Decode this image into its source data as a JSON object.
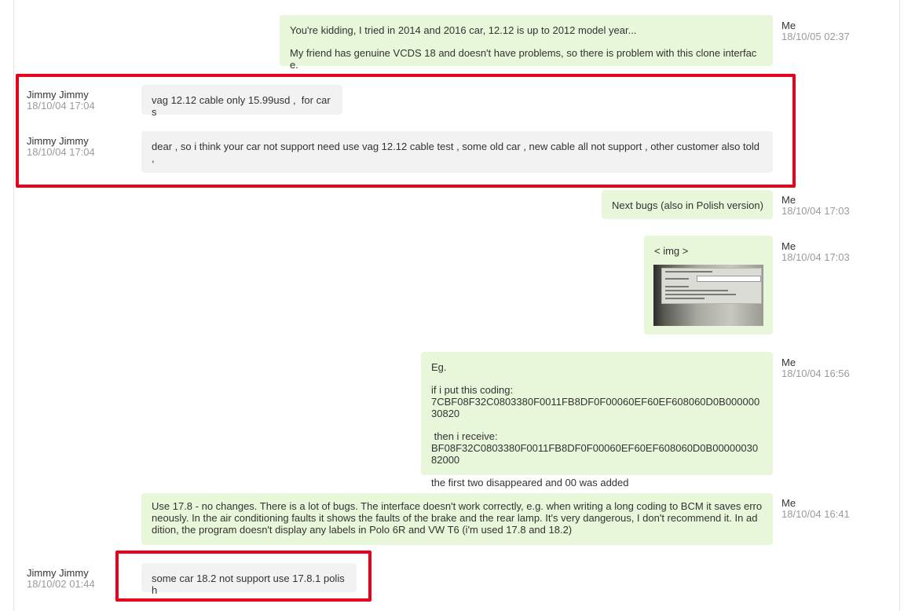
{
  "messages": [
    {
      "sender": "Me",
      "time": "18/10/05 02:37",
      "lines": [
        "You're kidding, I tried in 2014 and 2016 car, 12.12 is up to 2012 model year...",
        "My friend has genuine VCDS 18 and doesn't have problems, so there is problem with this clone interface."
      ]
    },
    {
      "sender": "Jimmy Jimmy",
      "time": "18/10/04 17:04",
      "lines": [
        "vag 12.12 cable only 15.99usd ,  for cars"
      ]
    },
    {
      "sender": "Jimmy Jimmy",
      "time": "18/10/04 17:04",
      "lines": [
        "dear , so i think your car not support need use vag 12.12 cable test , some old car , new cable all not support , other customer also told",
        ","
      ]
    },
    {
      "sender": "Me",
      "time": "18/10/04 17:03",
      "lines": [
        "Next bugs (also in Polish version)"
      ]
    },
    {
      "sender": "Me",
      "time": "18/10/04 17:03",
      "lines": [
        "< img >"
      ],
      "image_icon": "photo-thumbnail"
    },
    {
      "sender": "Me",
      "time": "18/10/04 16:56",
      "lines": [
        "Eg.",
        "if i put this coding:",
        "7CBF08F32C0803380F0011FB8DF0F00060EF60EF608060D0B00000030820",
        " then i receive:",
        "BF08F32C0803380F0011FB8DF0F00060EF60EF608060D0B0000003082000",
        "the first two disappeared and 00 was added"
      ]
    },
    {
      "sender": "Me",
      "time": "18/10/04 16:41",
      "lines": [
        "Use 17.8 - no changes. There is a lot of bugs. The interface doesn't work correctly, e.g. when writing a long coding to BCM it saves erro",
        "neously. In the air conditioning faults it shows the faults of the brake and the rear lamp. It's very dangerous, I don't recommend it. In ad",
        "dition, the program doesn't display any labels in Polo 6R and VW T6 (i'm used 17.8 and 18.2)"
      ]
    },
    {
      "sender": "Jimmy Jimmy",
      "time": "18/10/02 01:44",
      "lines": [
        "some car 18.2 not support use 17.8.1 polish"
      ]
    }
  ],
  "colors": {
    "me_bubble": "#e8f6d9",
    "them_bubble": "#f2f2f2",
    "highlight": "#e8001c",
    "time_text": "#9a9a9a"
  }
}
